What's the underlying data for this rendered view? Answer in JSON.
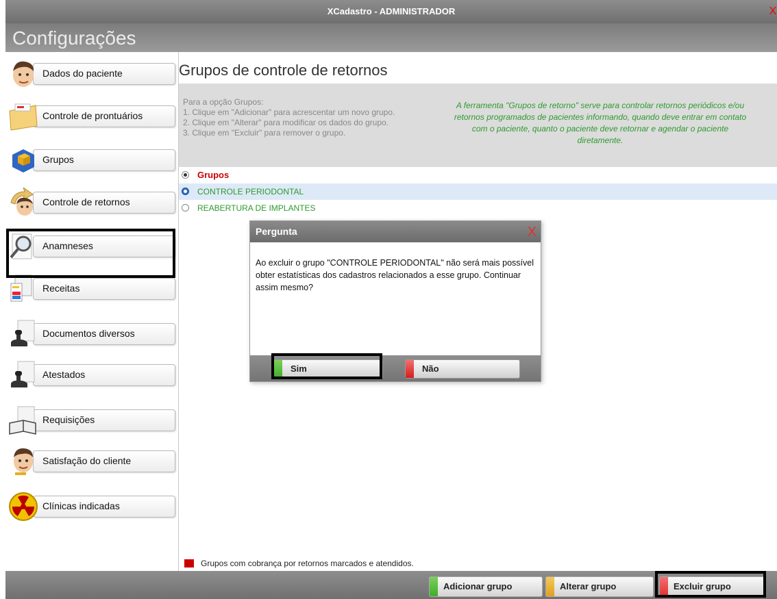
{
  "window": {
    "title": "XCadastro - ADMINISTRADOR",
    "close_glyph": "X"
  },
  "header": {
    "title": "Configurações"
  },
  "sidebar": {
    "items": [
      {
        "label": "Dados do paciente",
        "icon": "patient-face-icon"
      },
      {
        "label": "Controle de prontuários",
        "icon": "folder-records-icon"
      },
      {
        "label": "Grupos",
        "icon": "blue-cube-icon"
      },
      {
        "label": "Controle de retornos",
        "icon": "return-arrow-face-icon"
      },
      {
        "label": "Anamneses",
        "icon": "magnifier-icon"
      },
      {
        "label": "Receitas",
        "icon": "prescription-icon"
      },
      {
        "label": "Documentos diversos",
        "icon": "stamp-document-icon"
      },
      {
        "label": "Atestados",
        "icon": "stamp-certificate-icon"
      },
      {
        "label": "Requisições",
        "icon": "books-icon"
      },
      {
        "label": "Satisfação do cliente",
        "icon": "customer-face-icon"
      },
      {
        "label": "Clínicas indicadas",
        "icon": "radiation-icon"
      }
    ]
  },
  "main": {
    "title": "Grupos de controle de retornos",
    "instructions": [
      "Para a opção Grupos:",
      "1. Clique em \"Adicionar\" para acrescentar um novo grupo.",
      "2. Clique em \"Alterar\" para modificar os dados do grupo.",
      "3. Clique em \"Excluir\" para remover o grupo."
    ],
    "note": "A ferramenta \"Grupos de retorno\" serve para controlar retornos periódicos e/ou retornos programados de pacientes informando, quando deve entrar em contato com o paciente, quanto o paciente deve retornar e agendar o paciente diretamente.",
    "groups_header": "Grupos",
    "groups": [
      "CONTROLE PERIODONTAL",
      "REABERTURA DE IMPLANTES"
    ],
    "legend": "Grupos com cobrança por retornos marcados e atendidos."
  },
  "footer": {
    "add_label": "Adicionar grupo",
    "edit_label": "Alterar grupo",
    "delete_label": "Excluir grupo"
  },
  "dialog": {
    "title": "Pergunta",
    "close_glyph": "X",
    "message": "Ao excluir o grupo \"CONTROLE PERIODONTAL\" não será mais possível obter estatísticas dos cadastros relacionados a esse grupo. Continuar assim mesmo?",
    "yes_label": "Sim",
    "no_label": "Não"
  },
  "colors": {
    "green_text": "#2e9a2e",
    "red_header": "#cc0000",
    "selected_row": "#dde9f7",
    "btn_green": "#3fae2a",
    "btn_orange": "#e0a020",
    "btn_red": "#e03030"
  }
}
